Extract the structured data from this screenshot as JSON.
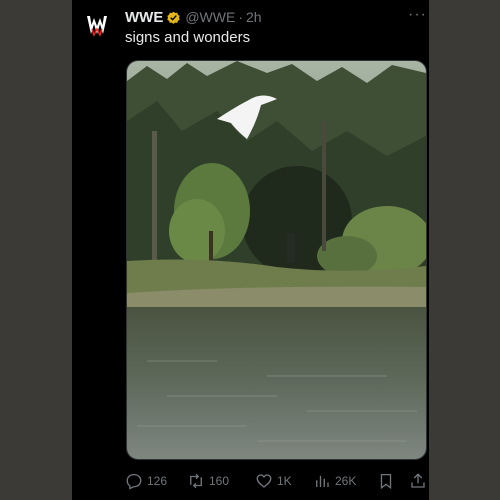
{
  "post": {
    "author_name": "WWE",
    "handle": "@WWE",
    "separator": "·",
    "time": "2h",
    "text": "signs and wonders",
    "more_label": "···",
    "verified": true
  },
  "actions": {
    "replies": "126",
    "reposts": "160",
    "likes": "1K",
    "views": "26K"
  },
  "icons": {
    "avatar": "wwe-logo-icon",
    "verified": "verified-badge-icon",
    "reply": "reply-icon",
    "repost": "repost-icon",
    "like": "heart-icon",
    "views": "views-chart-icon",
    "bookmark": "bookmark-icon",
    "share": "share-icon"
  },
  "colors": {
    "background": "#000000",
    "primary_text": "#e7e9ea",
    "secondary_text": "#71767b",
    "verified_gold": "#e2b719"
  }
}
